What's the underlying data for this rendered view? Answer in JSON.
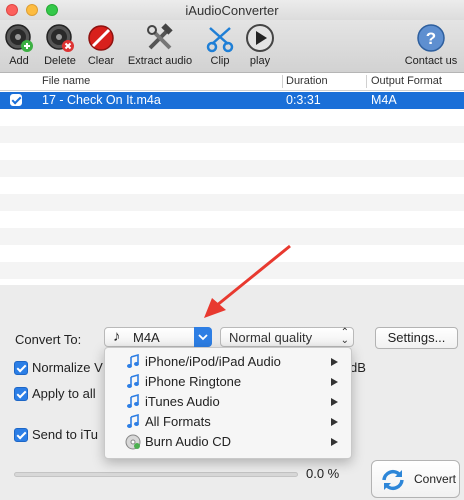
{
  "window": {
    "title": "iAudioConverter"
  },
  "toolbar": {
    "add": "Add",
    "delete": "Delete",
    "clear": "Clear",
    "extract": "Extract audio",
    "clip": "Clip",
    "play": "play",
    "contact": "Contact us"
  },
  "table": {
    "headers": {
      "file_name": "File name",
      "duration": "Duration",
      "output_format": "Output Format"
    },
    "rows": [
      {
        "checked": true,
        "file_name": "17 - Check On It.m4a",
        "duration": "0:3:31",
        "output_format": "M4A"
      }
    ]
  },
  "panel": {
    "convert_to_label": "Convert To:",
    "format_value": "M4A",
    "quality_value": "Normal quality",
    "settings_button": "Settings...",
    "normalize_label": "Normalize V",
    "db_suffix": "dB",
    "apply_label": "Apply to all",
    "send_label": "Send to iTu",
    "progress_text": "0.0 %",
    "progress_fraction": 0.0,
    "convert_button": "Convert"
  },
  "menu": {
    "items": [
      {
        "label": "iPhone/iPod/iPad Audio",
        "icon": "music-note-icon",
        "submenu": true
      },
      {
        "label": "iPhone Ringtone",
        "icon": "music-note-icon",
        "submenu": true
      },
      {
        "label": "iTunes Audio",
        "icon": "music-note-icon",
        "submenu": true
      },
      {
        "label": "All Formats",
        "icon": "music-note-icon",
        "submenu": true
      },
      {
        "label": "Burn Audio CD",
        "icon": "cd-icon",
        "submenu": true
      }
    ]
  },
  "colors": {
    "selection": "#1a6fd8",
    "accent": "#2b7ee6",
    "annotation_arrow": "#e8392f"
  }
}
